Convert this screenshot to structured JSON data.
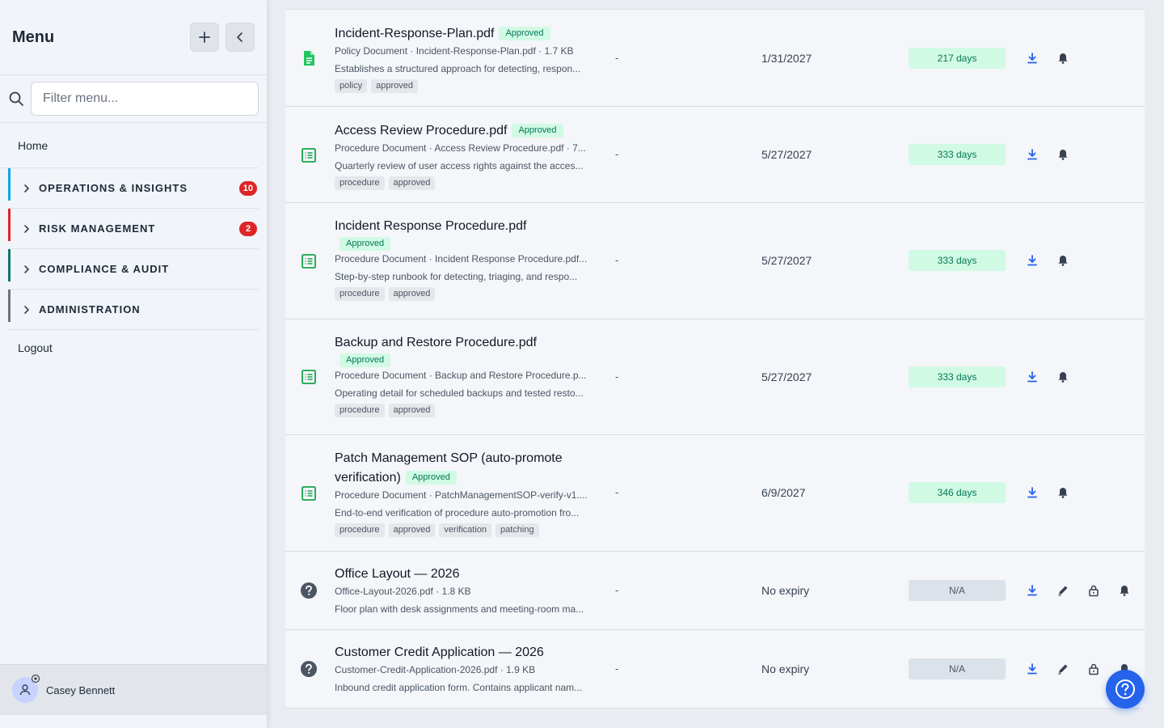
{
  "sidebar": {
    "title": "Menu",
    "search_placeholder": "Filter menu...",
    "home": "Home",
    "sections": [
      {
        "label": "OPERATIONS & INSIGHTS",
        "count": "10",
        "color": "#0ea5e9"
      },
      {
        "label": "RISK MANAGEMENT",
        "count": "2",
        "color": "#dc2626"
      },
      {
        "label": "COMPLIANCE & AUDIT",
        "count": "",
        "color": "#0f766e"
      },
      {
        "label": "ADMINISTRATION",
        "count": "",
        "color": "#6b7280"
      }
    ],
    "logout": "Logout",
    "user": "Casey Bennett"
  },
  "documents": [
    {
      "title": "Incident-Response-Plan.pdf",
      "badge": "Approved",
      "meta": "Policy Document · Incident-Response-Plan.pdf · 1.7 KB",
      "description": "Establishes a structured approach for detecting, respon...",
      "tags": [
        "policy",
        "approved"
      ],
      "owner": "-",
      "expiry": "1/31/2027",
      "days": "217 days",
      "icon": "file-green-icon"
    },
    {
      "title": "Access Review Procedure.pdf",
      "badge": "Approved",
      "meta": "Procedure Document · Access Review Procedure.pdf · 7...",
      "description": "Quarterly review of user access rights against the acces...",
      "tags": [
        "procedure",
        "approved"
      ],
      "owner": "-",
      "expiry": "5/27/2027",
      "days": "333 days",
      "icon": "list-doc-icon"
    },
    {
      "title": "Incident Response Procedure.pdf",
      "badge": "Approved",
      "meta": "Procedure Document · Incident Response Procedure.pdf...",
      "description": "Step-by-step runbook for detecting, triaging, and respo...",
      "tags": [
        "procedure",
        "approved"
      ],
      "owner": "-",
      "expiry": "5/27/2027",
      "days": "333 days",
      "icon": "list-doc-icon"
    },
    {
      "title": "Backup and Restore Procedure.pdf",
      "badge": "Approved",
      "meta": "Procedure Document · Backup and Restore Procedure.p...",
      "description": "Operating detail for scheduled backups and tested resto...",
      "tags": [
        "procedure",
        "approved"
      ],
      "owner": "-",
      "expiry": "5/27/2027",
      "days": "333 days",
      "icon": "list-doc-icon"
    },
    {
      "title": "Patch Management SOP (auto-promote verification)",
      "badge": "Approved",
      "meta": "Procedure Document · PatchManagementSOP-verify-v1....",
      "description": "End-to-end verification of procedure auto-promotion fro...",
      "tags": [
        "procedure",
        "approved",
        "verification",
        "patching"
      ],
      "owner": "-",
      "expiry": "6/9/2027",
      "days": "346 days",
      "icon": "list-doc-icon"
    },
    {
      "title": "Office Layout — 2026",
      "badge": "",
      "meta": "Office-Layout-2026.pdf · 1.8 KB",
      "description": "Floor plan with desk assignments and meeting-room ma...",
      "tags": [],
      "owner": "-",
      "expiry": "No expiry",
      "days": "N/A",
      "icon": "question-icon"
    },
    {
      "title": "Customer Credit Application — 2026",
      "badge": "",
      "meta": "Customer-Credit-Application-2026.pdf · 1.9 KB",
      "description": "Inbound credit application form. Contains applicant nam...",
      "tags": [],
      "owner": "-",
      "expiry": "No expiry",
      "days": "N/A",
      "icon": "question-icon"
    }
  ]
}
